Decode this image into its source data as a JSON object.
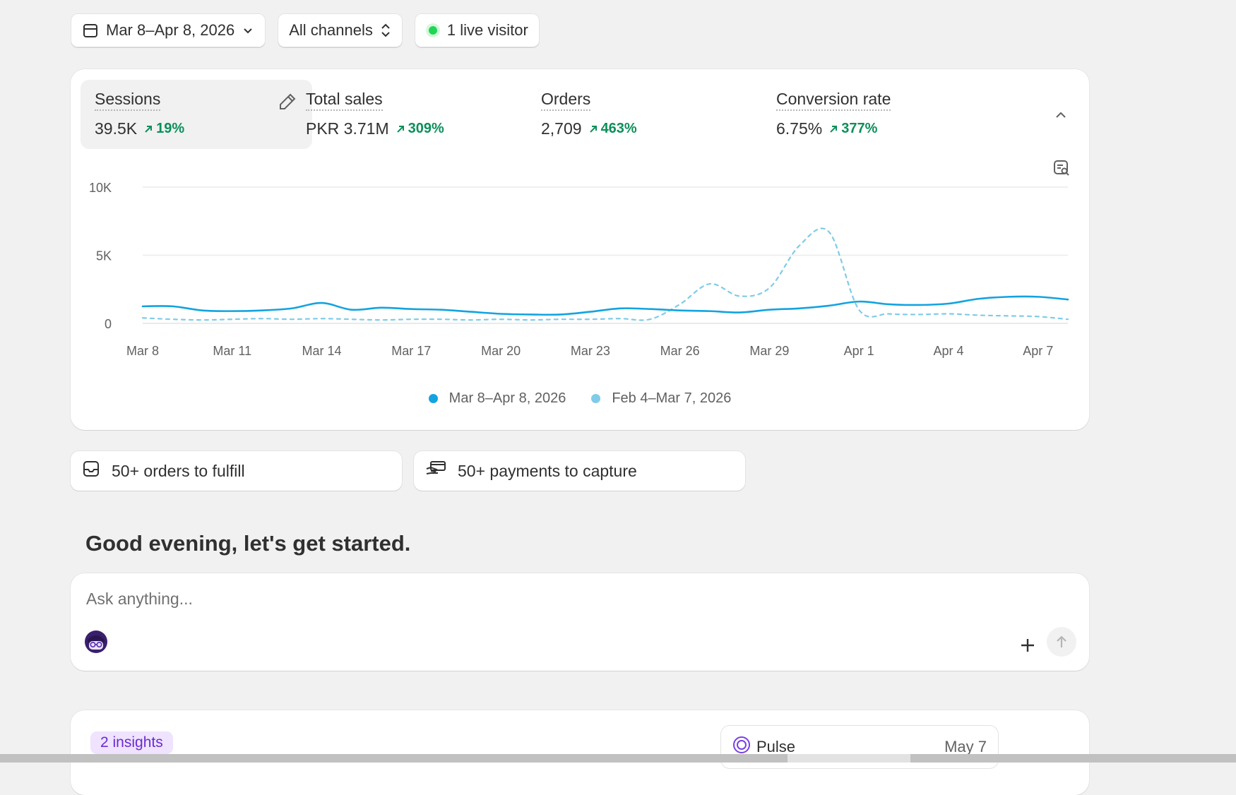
{
  "filters": {
    "date_range": "Mar 8–Apr 8, 2026",
    "channels": "All channels",
    "live_visitors": "1 live visitor"
  },
  "metrics": [
    {
      "label": "Sessions",
      "value": "39.5K",
      "delta": "19%"
    },
    {
      "label": "Total sales",
      "value": "PKR 3.71M",
      "delta": "309%"
    },
    {
      "label": "Orders",
      "value": "2,709",
      "delta": "463%"
    },
    {
      "label": "Conversion rate",
      "value": "6.75%",
      "delta": "377%"
    }
  ],
  "chart_data": {
    "type": "line",
    "x": [
      "Mar 8",
      "Mar 9",
      "Mar 10",
      "Mar 11",
      "Mar 12",
      "Mar 13",
      "Mar 14",
      "Mar 15",
      "Mar 16",
      "Mar 17",
      "Mar 18",
      "Mar 19",
      "Mar 20",
      "Mar 21",
      "Mar 22",
      "Mar 23",
      "Mar 24",
      "Mar 25",
      "Mar 26",
      "Mar 27",
      "Mar 28",
      "Mar 29",
      "Mar 30",
      "Mar 31",
      "Apr 1",
      "Apr 2",
      "Apr 3",
      "Apr 4",
      "Apr 5",
      "Apr 6",
      "Apr 7",
      "Apr 8"
    ],
    "tick_labels": [
      "Mar 8",
      "Mar 11",
      "Mar 14",
      "Mar 17",
      "Mar 20",
      "Mar 23",
      "Mar 26",
      "Mar 29",
      "Apr 1",
      "Apr 4",
      "Apr 7"
    ],
    "y_ticks": [
      "10K",
      "5K",
      "0"
    ],
    "ylim": [
      0,
      10000
    ],
    "grid": true,
    "legend_position": "bottom-center",
    "series": [
      {
        "name": "Mar 8–Apr 8, 2026",
        "color": "#13a3e0",
        "style": "solid",
        "values": [
          1250,
          1250,
          950,
          900,
          950,
          1100,
          1500,
          1000,
          1150,
          1050,
          1000,
          850,
          700,
          650,
          650,
          850,
          1100,
          1050,
          950,
          900,
          800,
          1000,
          1100,
          1300,
          1600,
          1400,
          1350,
          1450,
          1800,
          1950,
          1950,
          1750
        ]
      },
      {
        "name": "Feb 4–Mar 7, 2026",
        "color": "#7fcbe8",
        "style": "dashed",
        "values": [
          400,
          300,
          250,
          300,
          350,
          300,
          350,
          300,
          250,
          300,
          300,
          250,
          300,
          250,
          300,
          300,
          350,
          300,
          1400,
          2900,
          2000,
          2600,
          5700,
          6700,
          1000,
          700,
          650,
          700,
          600,
          550,
          500,
          300
        ]
      }
    ]
  },
  "tasks": {
    "fulfill": "50+ orders to fulfill",
    "capture": "50+ payments to capture"
  },
  "greeting": "Good evening, let's get started.",
  "ask": {
    "placeholder": "Ask anything..."
  },
  "insights": {
    "badge": "2 insights",
    "pulse_label": "Pulse",
    "pulse_date": "May 7"
  },
  "colors": {
    "accent_green": "#0c8f5a",
    "live_dot": "#1fd654",
    "insight_purple": "#6b2bd1"
  }
}
